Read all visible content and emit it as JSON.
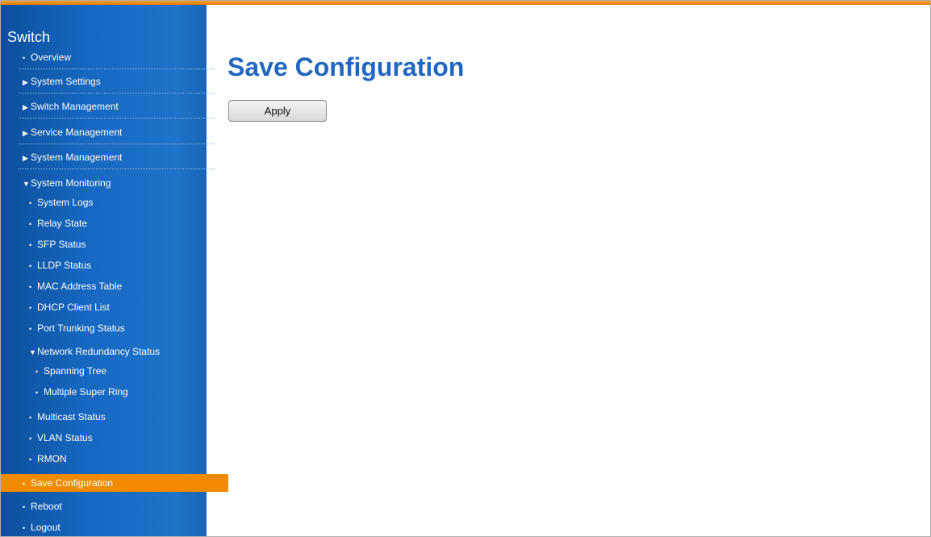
{
  "sidebar": {
    "title": "Switch",
    "items": [
      {
        "mark": "•",
        "label": "Overview"
      },
      {
        "mark": "▶",
        "label": "System Settings"
      },
      {
        "mark": "▶",
        "label": "Switch Management"
      },
      {
        "mark": "▶",
        "label": "Service Management"
      },
      {
        "mark": "▶",
        "label": "System Management"
      },
      {
        "mark": "▼",
        "label": "System Monitoring"
      },
      {
        "mark": "•",
        "label": "System Logs"
      },
      {
        "mark": "•",
        "label": "Relay State"
      },
      {
        "mark": "•",
        "label": "SFP Status"
      },
      {
        "mark": "•",
        "label": "LLDP Status"
      },
      {
        "mark": "•",
        "label": "MAC Address Table"
      },
      {
        "mark": "•",
        "label": "DHCP Client List"
      },
      {
        "mark": "•",
        "label": "Port Trunking Status"
      },
      {
        "mark": "▼",
        "label": "Network Redundancy Status"
      },
      {
        "mark": "•",
        "label": "Spanning Tree"
      },
      {
        "mark": "•",
        "label": "Multiple Super Ring"
      },
      {
        "mark": "•",
        "label": "Multicast Status"
      },
      {
        "mark": "•",
        "label": "VLAN Status"
      },
      {
        "mark": "•",
        "label": "RMON"
      },
      {
        "mark": "•",
        "label": "Save Configuration"
      },
      {
        "mark": "•",
        "label": "Reboot"
      },
      {
        "mark": "•",
        "label": "Logout"
      }
    ]
  },
  "main": {
    "title": "Save Configuration",
    "apply_label": "Apply"
  },
  "colors": {
    "accent_orange": "#f28a00",
    "sidebar_blue": "#1667c0",
    "title_blue": "#1f67c0"
  }
}
